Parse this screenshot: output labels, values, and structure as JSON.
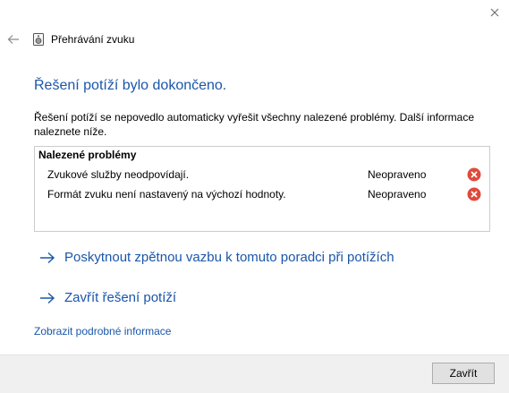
{
  "window": {
    "title": "Přehrávání zvuku"
  },
  "main": {
    "heading": "Řešení potíží bylo dokončeno.",
    "description": "Řešení potíží se nepovedlo automaticky vyřešit všechny nalezené problémy. Další informace naleznete níže."
  },
  "problems": {
    "header": "Nalezené problémy",
    "items": [
      {
        "text": "Zvukové služby neodpovídají.",
        "status": "Neopraveno"
      },
      {
        "text": "Formát zvuku není nastavený na výchozí hodnoty.",
        "status": "Neopraveno"
      }
    ]
  },
  "actions": [
    {
      "label": "Poskytnout zpětnou vazbu k tomuto poradci při potížích"
    },
    {
      "label": "Zavřít řešení potíží"
    }
  ],
  "details_link": "Zobrazit podrobné informace",
  "footer": {
    "close_button": "Zavřít"
  },
  "icons": {
    "back": "back-arrow-icon",
    "app": "speaker-icon",
    "close": "close-icon",
    "error": "error-icon",
    "action_arrow": "arrow-right-icon"
  },
  "colors": {
    "link": "#1a56a8",
    "error": "#e04a3a",
    "footer_bg": "#f0f0f0"
  }
}
